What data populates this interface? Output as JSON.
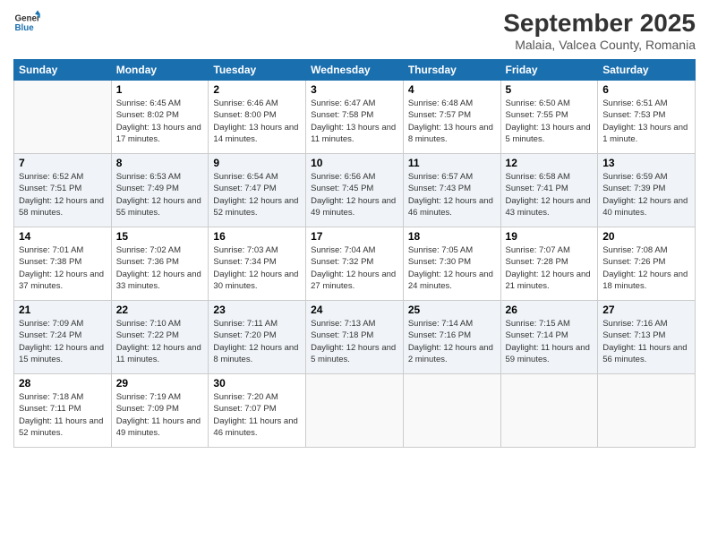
{
  "header": {
    "logo_line1": "General",
    "logo_line2": "Blue",
    "month": "September 2025",
    "location": "Malaia, Valcea County, Romania"
  },
  "weekdays": [
    "Sunday",
    "Monday",
    "Tuesday",
    "Wednesday",
    "Thursday",
    "Friday",
    "Saturday"
  ],
  "weeks": [
    [
      {
        "day": "",
        "sunrise": "",
        "sunset": "",
        "daylight": ""
      },
      {
        "day": "1",
        "sunrise": "Sunrise: 6:45 AM",
        "sunset": "Sunset: 8:02 PM",
        "daylight": "Daylight: 13 hours and 17 minutes."
      },
      {
        "day": "2",
        "sunrise": "Sunrise: 6:46 AM",
        "sunset": "Sunset: 8:00 PM",
        "daylight": "Daylight: 13 hours and 14 minutes."
      },
      {
        "day": "3",
        "sunrise": "Sunrise: 6:47 AM",
        "sunset": "Sunset: 7:58 PM",
        "daylight": "Daylight: 13 hours and 11 minutes."
      },
      {
        "day": "4",
        "sunrise": "Sunrise: 6:48 AM",
        "sunset": "Sunset: 7:57 PM",
        "daylight": "Daylight: 13 hours and 8 minutes."
      },
      {
        "day": "5",
        "sunrise": "Sunrise: 6:50 AM",
        "sunset": "Sunset: 7:55 PM",
        "daylight": "Daylight: 13 hours and 5 minutes."
      },
      {
        "day": "6",
        "sunrise": "Sunrise: 6:51 AM",
        "sunset": "Sunset: 7:53 PM",
        "daylight": "Daylight: 13 hours and 1 minute."
      }
    ],
    [
      {
        "day": "7",
        "sunrise": "Sunrise: 6:52 AM",
        "sunset": "Sunset: 7:51 PM",
        "daylight": "Daylight: 12 hours and 58 minutes."
      },
      {
        "day": "8",
        "sunrise": "Sunrise: 6:53 AM",
        "sunset": "Sunset: 7:49 PM",
        "daylight": "Daylight: 12 hours and 55 minutes."
      },
      {
        "day": "9",
        "sunrise": "Sunrise: 6:54 AM",
        "sunset": "Sunset: 7:47 PM",
        "daylight": "Daylight: 12 hours and 52 minutes."
      },
      {
        "day": "10",
        "sunrise": "Sunrise: 6:56 AM",
        "sunset": "Sunset: 7:45 PM",
        "daylight": "Daylight: 12 hours and 49 minutes."
      },
      {
        "day": "11",
        "sunrise": "Sunrise: 6:57 AM",
        "sunset": "Sunset: 7:43 PM",
        "daylight": "Daylight: 12 hours and 46 minutes."
      },
      {
        "day": "12",
        "sunrise": "Sunrise: 6:58 AM",
        "sunset": "Sunset: 7:41 PM",
        "daylight": "Daylight: 12 hours and 43 minutes."
      },
      {
        "day": "13",
        "sunrise": "Sunrise: 6:59 AM",
        "sunset": "Sunset: 7:39 PM",
        "daylight": "Daylight: 12 hours and 40 minutes."
      }
    ],
    [
      {
        "day": "14",
        "sunrise": "Sunrise: 7:01 AM",
        "sunset": "Sunset: 7:38 PM",
        "daylight": "Daylight: 12 hours and 37 minutes."
      },
      {
        "day": "15",
        "sunrise": "Sunrise: 7:02 AM",
        "sunset": "Sunset: 7:36 PM",
        "daylight": "Daylight: 12 hours and 33 minutes."
      },
      {
        "day": "16",
        "sunrise": "Sunrise: 7:03 AM",
        "sunset": "Sunset: 7:34 PM",
        "daylight": "Daylight: 12 hours and 30 minutes."
      },
      {
        "day": "17",
        "sunrise": "Sunrise: 7:04 AM",
        "sunset": "Sunset: 7:32 PM",
        "daylight": "Daylight: 12 hours and 27 minutes."
      },
      {
        "day": "18",
        "sunrise": "Sunrise: 7:05 AM",
        "sunset": "Sunset: 7:30 PM",
        "daylight": "Daylight: 12 hours and 24 minutes."
      },
      {
        "day": "19",
        "sunrise": "Sunrise: 7:07 AM",
        "sunset": "Sunset: 7:28 PM",
        "daylight": "Daylight: 12 hours and 21 minutes."
      },
      {
        "day": "20",
        "sunrise": "Sunrise: 7:08 AM",
        "sunset": "Sunset: 7:26 PM",
        "daylight": "Daylight: 12 hours and 18 minutes."
      }
    ],
    [
      {
        "day": "21",
        "sunrise": "Sunrise: 7:09 AM",
        "sunset": "Sunset: 7:24 PM",
        "daylight": "Daylight: 12 hours and 15 minutes."
      },
      {
        "day": "22",
        "sunrise": "Sunrise: 7:10 AM",
        "sunset": "Sunset: 7:22 PM",
        "daylight": "Daylight: 12 hours and 11 minutes."
      },
      {
        "day": "23",
        "sunrise": "Sunrise: 7:11 AM",
        "sunset": "Sunset: 7:20 PM",
        "daylight": "Daylight: 12 hours and 8 minutes."
      },
      {
        "day": "24",
        "sunrise": "Sunrise: 7:13 AM",
        "sunset": "Sunset: 7:18 PM",
        "daylight": "Daylight: 12 hours and 5 minutes."
      },
      {
        "day": "25",
        "sunrise": "Sunrise: 7:14 AM",
        "sunset": "Sunset: 7:16 PM",
        "daylight": "Daylight: 12 hours and 2 minutes."
      },
      {
        "day": "26",
        "sunrise": "Sunrise: 7:15 AM",
        "sunset": "Sunset: 7:14 PM",
        "daylight": "Daylight: 11 hours and 59 minutes."
      },
      {
        "day": "27",
        "sunrise": "Sunrise: 7:16 AM",
        "sunset": "Sunset: 7:13 PM",
        "daylight": "Daylight: 11 hours and 56 minutes."
      }
    ],
    [
      {
        "day": "28",
        "sunrise": "Sunrise: 7:18 AM",
        "sunset": "Sunset: 7:11 PM",
        "daylight": "Daylight: 11 hours and 52 minutes."
      },
      {
        "day": "29",
        "sunrise": "Sunrise: 7:19 AM",
        "sunset": "Sunset: 7:09 PM",
        "daylight": "Daylight: 11 hours and 49 minutes."
      },
      {
        "day": "30",
        "sunrise": "Sunrise: 7:20 AM",
        "sunset": "Sunset: 7:07 PM",
        "daylight": "Daylight: 11 hours and 46 minutes."
      },
      {
        "day": "",
        "sunrise": "",
        "sunset": "",
        "daylight": ""
      },
      {
        "day": "",
        "sunrise": "",
        "sunset": "",
        "daylight": ""
      },
      {
        "day": "",
        "sunrise": "",
        "sunset": "",
        "daylight": ""
      },
      {
        "day": "",
        "sunrise": "",
        "sunset": "",
        "daylight": ""
      }
    ]
  ]
}
